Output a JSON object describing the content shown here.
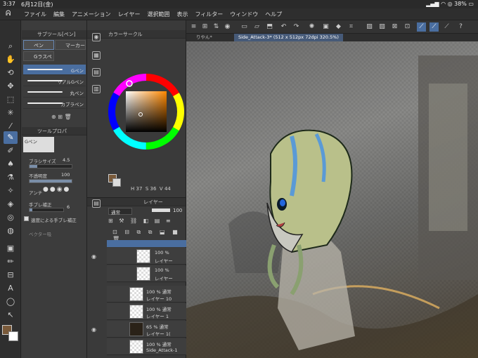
{
  "status": {
    "time": "3:37",
    "date": "6月12日(金)",
    "battery": "38%"
  },
  "menu": {
    "items": [
      "ファイル",
      "編集",
      "アニメーション",
      "レイヤー",
      "選択範囲",
      "表示",
      "フィルター",
      "ウィンドウ",
      "ヘルプ"
    ]
  },
  "subtool": {
    "title": "サブツール[ペン]",
    "tabs": [
      "ペン",
      "マーカー",
      "Gラスペ"
    ],
    "brushes": [
      "Gペン",
      "リアルGペン",
      "丸ペン",
      "カブラペン"
    ],
    "selected_brush": "Gペン"
  },
  "toolprop": {
    "title": "ツールプロパ",
    "preset": "Gペン",
    "brush_size_label": "ブラシサイズ",
    "brush_size_value": "4.5",
    "opacity_label": "不透明度",
    "opacity_value": "100",
    "antialias_label": "アンチ",
    "stabilization_label": "手ブレ補正",
    "stabilization_value": "6",
    "speed_stabilization_label": "速度による手ブレ補正",
    "vector_label": "ベクター吸"
  },
  "colorpanel": {
    "title": "カラーサークル",
    "h": "37",
    "s": "36",
    "v": "44",
    "main_color": "#7a5a3a"
  },
  "layerpanel": {
    "title": "レイヤー",
    "blend": "通常",
    "opacity": "100",
    "layers": [
      {
        "pct": "100 %",
        "name": "レイヤー",
        "visible": true,
        "indent": true
      },
      {
        "pct": "100 %",
        "name": "レイヤー",
        "visible": false,
        "indent": true
      },
      {
        "pct": "100 % 通常",
        "name": "レイヤー 10",
        "visible": false,
        "indent": false
      },
      {
        "pct": "100 % 通常",
        "name": "レイヤー 1",
        "visible": false,
        "indent": false
      },
      {
        "pct": "65 % 通常",
        "name": "レイヤー 1(",
        "visible": true,
        "indent": false
      },
      {
        "pct": "100 % 通常",
        "name": "Side_Attack-1",
        "visible": false,
        "indent": false
      }
    ]
  },
  "canvas": {
    "tabs": [
      "りやん*",
      "Side_Attack-3* (512 x 512px 72dpi 320.5%)"
    ],
    "active_tab": 1
  },
  "colors": {
    "accent": "#4a6ea0",
    "panel": "#3a3a3a"
  }
}
